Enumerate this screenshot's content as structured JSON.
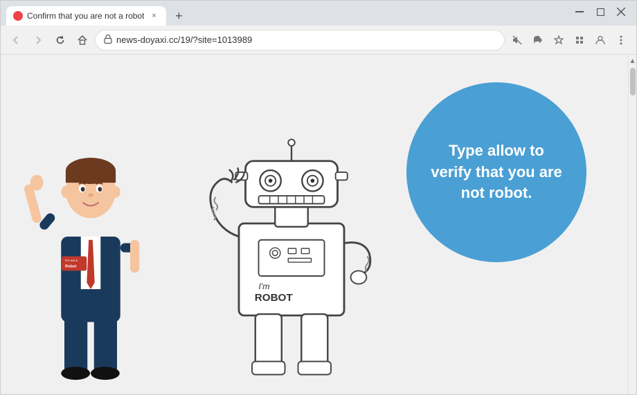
{
  "browser": {
    "tab": {
      "favicon_color": "#e44",
      "title": "Confirm that you are not a robot",
      "close_label": "×"
    },
    "new_tab_label": "+",
    "window_controls": {
      "minimize": "—",
      "maximize": "□",
      "close": "✕"
    },
    "toolbar": {
      "back_label": "←",
      "forward_label": "→",
      "reload_label": "↻",
      "home_label": "⌂",
      "url": "news-doyaxi.cc/19/?site=1013989",
      "lock_icon": "🔒",
      "bookmark_icon": "☆",
      "extensions_icon": "🧩",
      "profile_icon": "👤",
      "menu_icon": "⋮",
      "mute_icon": "🔇",
      "share_icon": "⎙"
    }
  },
  "page": {
    "background_color": "#f0f0f0",
    "circle": {
      "color": "#4a9fd4",
      "text": "Type allow to verify that you are not robot."
    },
    "person": {
      "badge_text": "I'm not a Robot"
    },
    "robot": {
      "text": "I'm ROBOT"
    }
  }
}
